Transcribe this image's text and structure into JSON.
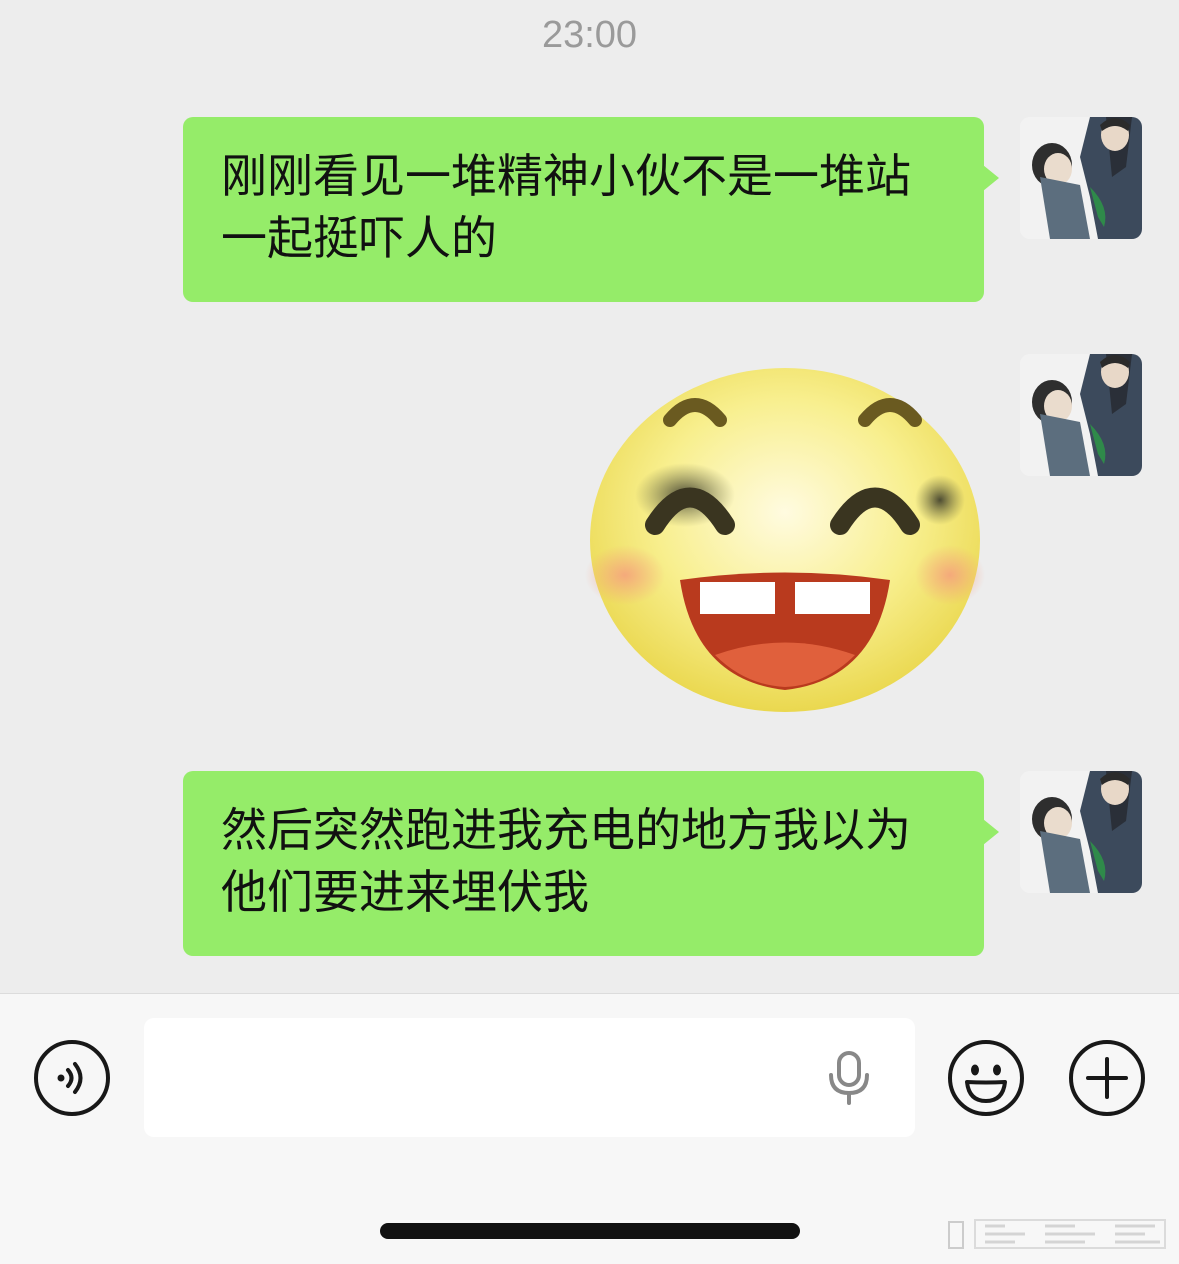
{
  "chat": {
    "timestamp": "23:00",
    "messages": [
      {
        "type": "text",
        "side": "right",
        "text": "刚刚看见一堆精神小伙不是一堆站一起挺吓人的"
      },
      {
        "type": "sticker",
        "side": "right",
        "icon": "grinning-bruised-face-sticker"
      },
      {
        "type": "text",
        "side": "right",
        "text": "然后突然跑进我充电的地方我以为他们要进来埋伏我"
      }
    ]
  },
  "input_bar": {
    "voice_icon": "voice-mode-icon",
    "text_value": "",
    "mic_icon": "microphone-icon",
    "emoji_icon": "emoji-icon",
    "plus_icon": "plus-icon"
  },
  "colors": {
    "background": "#ededed",
    "sent_bubble": "#95ec69",
    "input_bar": "#f7f7f7"
  }
}
